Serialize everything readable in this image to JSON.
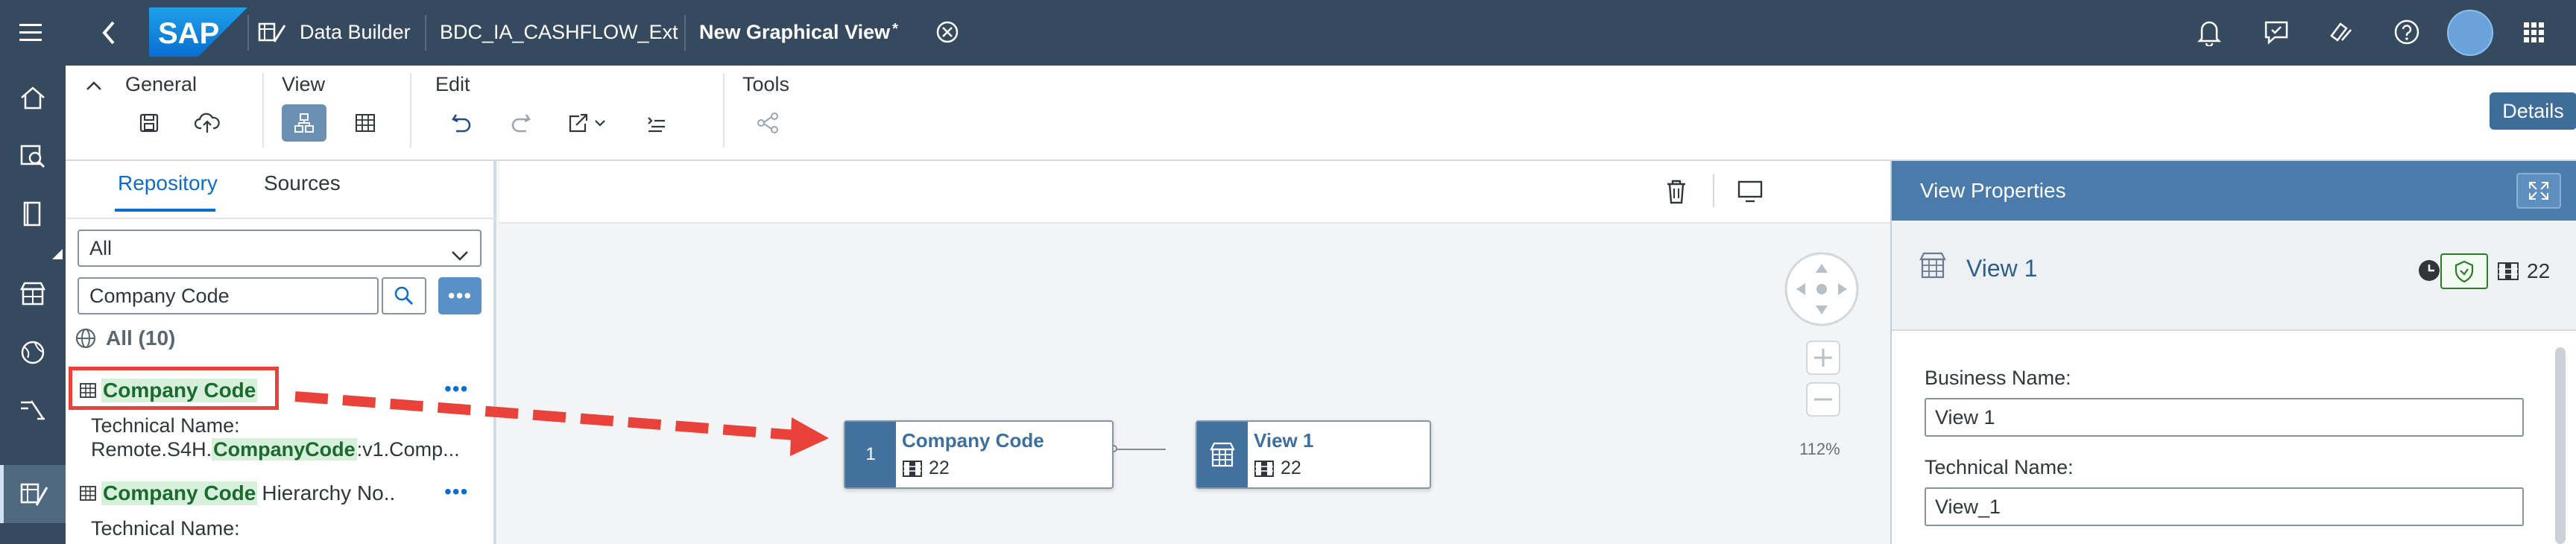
{
  "shell": {
    "app_name": "Data Builder",
    "space_name": "BDC_IA_CASHFLOW_Ext",
    "editor_title": "New Graphical View",
    "unsaved_marker": "*",
    "logo_text": "SAP"
  },
  "toolbar": {
    "groups": {
      "general": "General",
      "view": "View",
      "edit": "Edit",
      "tools": "Tools"
    },
    "details_label": "Details"
  },
  "repository": {
    "tabs": [
      "Repository",
      "Sources"
    ],
    "filter_value": "All",
    "search_value": "Company Code",
    "more_label": "•••",
    "all_label": "All (10)",
    "results": [
      {
        "title_hl": "Company Code",
        "title_rest": "",
        "sub_label": "Technical Name:",
        "sub_pre": "Remote.S4H.",
        "sub_hl": "CompanyCode",
        "sub_post": ":v1.Comp..."
      },
      {
        "title_hl": "Company Code",
        "title_rest": " Hierarchy No..",
        "sub_label": "Technical Name:"
      }
    ],
    "row_more": "•••"
  },
  "canvas": {
    "nodes": [
      {
        "side_label": "1",
        "title": "Company Code",
        "count": "22"
      },
      {
        "title": "View 1",
        "count": "22"
      }
    ],
    "zoom": "112%"
  },
  "properties": {
    "title": "View Properties",
    "object_name": "View 1",
    "column_count": "22",
    "business_name_label": "Business Name:",
    "business_name_value": "View 1",
    "technical_name_label": "Technical Name:",
    "technical_name_value": "View_1"
  },
  "colors": {
    "shell": "#354a5f",
    "accent": "#0a6ed1",
    "annotation_red": "#e8423a",
    "node_blue": "#42719e",
    "panel_header": "#4a7bab"
  },
  "icons": [
    "menu-icon",
    "back-icon",
    "data-builder-icon",
    "close-tab-icon",
    "bell-icon",
    "feedback-icon",
    "support-icon",
    "help-icon",
    "avatar",
    "app-grid-icon",
    "home-icon",
    "search-data-icon",
    "catalog-icon",
    "data-builder-nav-icon",
    "globe-icon",
    "connections-icon",
    "save-icon",
    "deploy-icon",
    "diagram-icon",
    "table-view-icon",
    "undo-icon",
    "redo-icon",
    "export-icon",
    "sql-icon",
    "impact-lineage-icon",
    "trash-icon",
    "monitor-icon",
    "pan-control",
    "zoom-in-icon",
    "zoom-out-icon",
    "expand-icon",
    "clock-icon",
    "shield-icon",
    "columns-icon"
  ]
}
